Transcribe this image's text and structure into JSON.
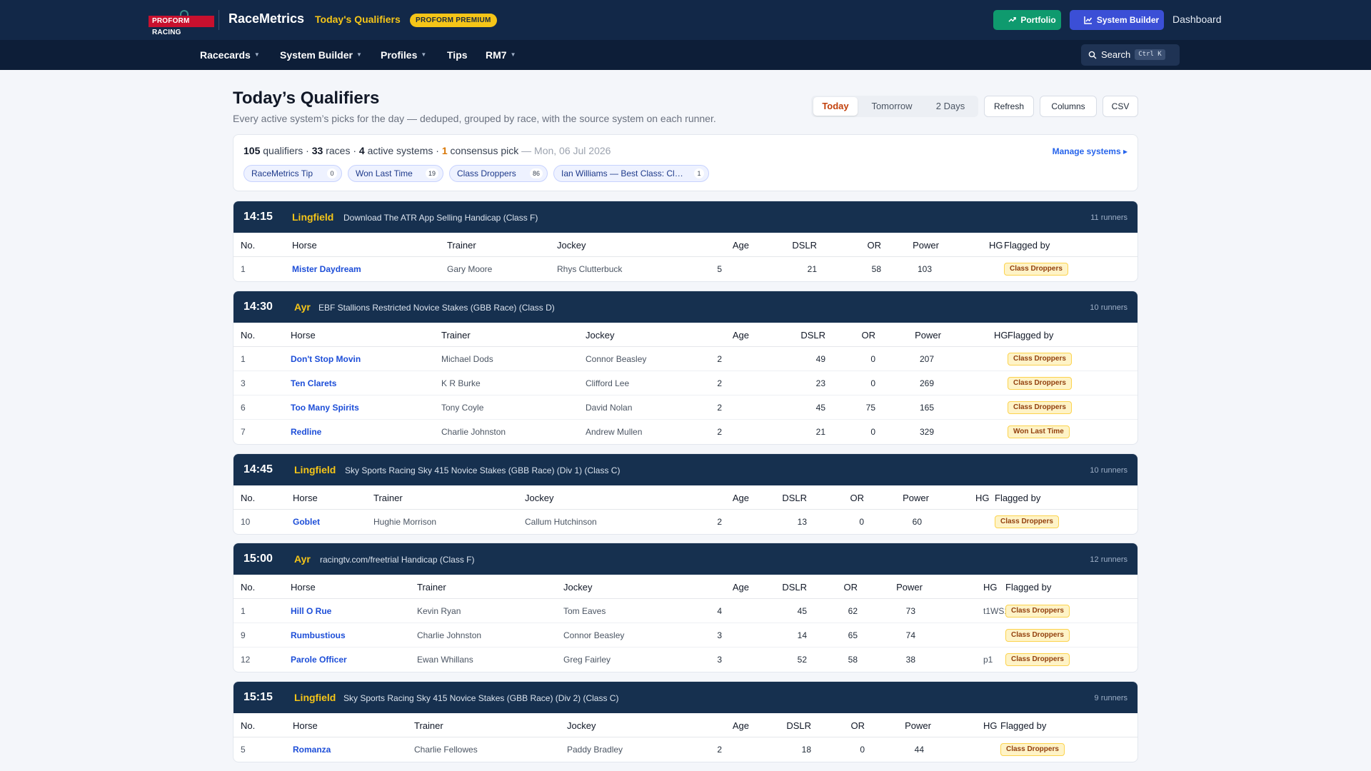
{
  "topbar": {
    "logo_text": "PROFORM RACING",
    "brand": "RaceMetrics",
    "crumb": "Today's Qualifiers",
    "premium_badge": "PROFORM PREMIUM",
    "portfolio_label": "Portfolio",
    "system_builder_label": "System Builder",
    "dashboard_label": "Dashboard",
    "colors": {
      "bar": "#122848",
      "accent": "#f5c518",
      "portfolio": "#0f9a6e",
      "system_builder": "#3b4fd6"
    }
  },
  "nav": {
    "items": [
      {
        "label": "Racecards",
        "dropdown": true
      },
      {
        "label": "System Builder",
        "dropdown": true
      },
      {
        "label": "Profiles",
        "dropdown": true
      },
      {
        "label": "Tips",
        "dropdown": false
      },
      {
        "label": "RM7",
        "dropdown": true
      }
    ],
    "search_label": "Search",
    "search_shortcut": "Ctrl K"
  },
  "header": {
    "title": "Today’s Qualifiers",
    "subtitle": "Every active system’s picks for the day — deduped, grouped by race, with the source system on each runner.",
    "day_options": [
      "Today",
      "Tomorrow",
      "2 Days"
    ],
    "selected_day": "Today",
    "refresh_label": "Refresh",
    "columns_label": "Columns",
    "csv_label": "CSV"
  },
  "summary": {
    "qualifiers": "105",
    "qualifiers_label": "qualifiers",
    "races": "33",
    "races_label": "races",
    "systems": "4",
    "systems_label": "active systems",
    "consensus": "1",
    "consensus_label": "consensus pick",
    "date": "Mon, 06 Jul 2026",
    "manage_label": "Manage systems ▸",
    "systems_list": [
      {
        "name": "RaceMetrics Tip",
        "count": "0"
      },
      {
        "name": "Won Last Time",
        "count": "19"
      },
      {
        "name": "Class Droppers",
        "count": "86"
      },
      {
        "name": "Ian Williams — Best Class: Cl…",
        "count": "1"
      }
    ]
  },
  "columns": [
    "No.",
    "Horse",
    "Trainer",
    "Jockey",
    "Age",
    "DSLR",
    "OR",
    "Power",
    "HG",
    "Flagged by"
  ],
  "races": [
    {
      "time": "14:15",
      "course": "Lingfield",
      "name": "Download The ATR App Selling Handicap (Class F)",
      "runners": "11 runners",
      "rows": [
        {
          "no": "1",
          "horse": "Mister Daydream",
          "trainer": "Gary Moore",
          "jockey": "Rhys Clutterbuck",
          "age": "5",
          "dslr": "21",
          "or": "58",
          "power": "103",
          "hg": "",
          "flag": "Class Droppers"
        }
      ]
    },
    {
      "time": "14:30",
      "course": "Ayr",
      "name": "EBF Stallions Restricted Novice Stakes (GBB Race) (Class D)",
      "runners": "10 runners",
      "rows": [
        {
          "no": "1",
          "horse": "Don't Stop Movin",
          "trainer": "Michael Dods",
          "jockey": "Connor Beasley",
          "age": "2",
          "dslr": "49",
          "or": "0",
          "power": "207",
          "hg": "",
          "flag": "Class Droppers"
        },
        {
          "no": "3",
          "horse": "Ten Clarets",
          "trainer": "K R Burke",
          "jockey": "Clifford Lee",
          "age": "2",
          "dslr": "23",
          "or": "0",
          "power": "269",
          "hg": "",
          "flag": "Class Droppers"
        },
        {
          "no": "6",
          "horse": "Too Many Spirits",
          "trainer": "Tony Coyle",
          "jockey": "David Nolan",
          "age": "2",
          "dslr": "45",
          "or": "75",
          "power": "165",
          "hg": "",
          "flag": "Class Droppers"
        },
        {
          "no": "7",
          "horse": "Redline",
          "trainer": "Charlie Johnston",
          "jockey": "Andrew Mullen",
          "age": "2",
          "dslr": "21",
          "or": "0",
          "power": "329",
          "hg": "",
          "flag": "Won Last Time"
        }
      ]
    },
    {
      "time": "14:45",
      "course": "Lingfield",
      "name": "Sky Sports Racing Sky 415 Novice Stakes (GBB Race) (Div 1) (Class C)",
      "runners": "10 runners",
      "rows": [
        {
          "no": "10",
          "horse": "Goblet",
          "trainer": "Hughie Morrison",
          "jockey": "Callum Hutchinson",
          "age": "2",
          "dslr": "13",
          "or": "0",
          "power": "60",
          "hg": "",
          "flag": "Class Droppers"
        }
      ]
    },
    {
      "time": "15:00",
      "course": "Ayr",
      "name": "racingtv.com/freetrial Handicap (Class F)",
      "runners": "12 runners",
      "rows": [
        {
          "no": "1",
          "horse": "Hill O Rue",
          "trainer": "Kevin Ryan",
          "jockey": "Tom Eaves",
          "age": "4",
          "dslr": "45",
          "or": "62",
          "power": "73",
          "hg": "t1WS1",
          "flag": "Class Droppers"
        },
        {
          "no": "9",
          "horse": "Rumbustious",
          "trainer": "Charlie Johnston",
          "jockey": "Connor Beasley",
          "age": "3",
          "dslr": "14",
          "or": "65",
          "power": "74",
          "hg": "",
          "flag": "Class Droppers"
        },
        {
          "no": "12",
          "horse": "Parole Officer",
          "trainer": "Ewan Whillans",
          "jockey": "Greg Fairley",
          "age": "3",
          "dslr": "52",
          "or": "58",
          "power": "38",
          "hg": "p1",
          "flag": "Class Droppers"
        }
      ]
    },
    {
      "time": "15:15",
      "course": "Lingfield",
      "name": "Sky Sports Racing Sky 415 Novice Stakes (GBB Race) (Div 2) (Class C)",
      "runners": "9 runners",
      "rows": [
        {
          "no": "5",
          "horse": "Romanza",
          "trainer": "Charlie Fellowes",
          "jockey": "Paddy Bradley",
          "age": "2",
          "dslr": "18",
          "or": "0",
          "power": "44",
          "hg": "",
          "flag": "Class Droppers"
        }
      ]
    }
  ]
}
